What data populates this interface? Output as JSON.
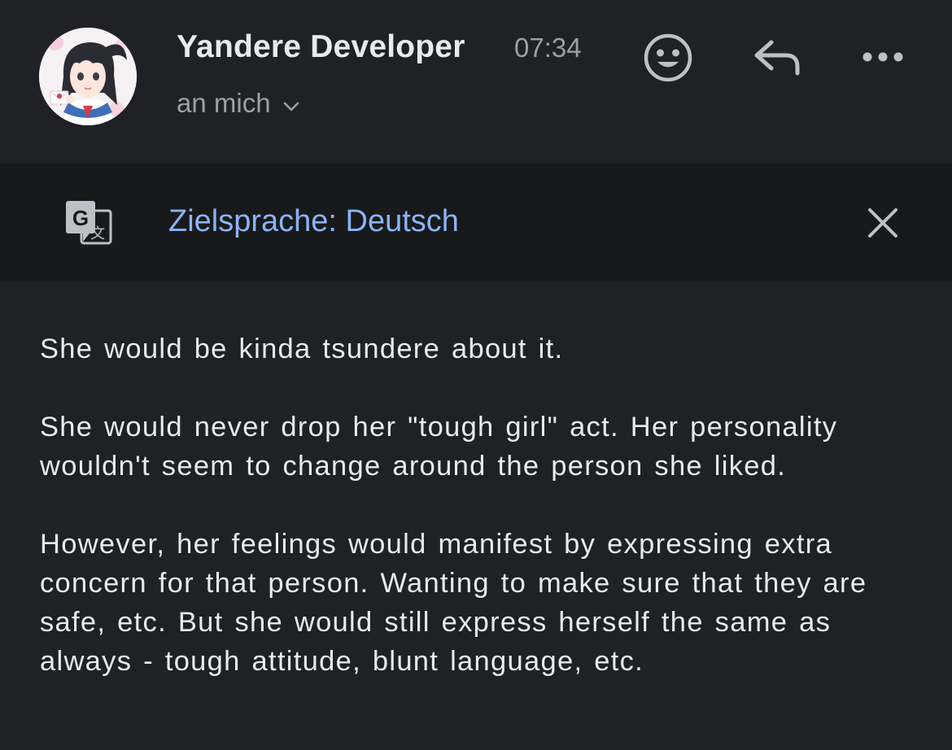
{
  "header": {
    "sender": "Yandere Developer",
    "time": "07:34",
    "recipient": "an mich",
    "avatar": "sender-avatar-anime-girl",
    "actions": [
      "emoji-icon",
      "reply-icon",
      "more-icon"
    ]
  },
  "translate_bar": {
    "label": "Zielsprache: Deutsch",
    "icon": "google-translate-icon",
    "close_icon": "close-icon"
  },
  "message": {
    "paragraphs": [
      "She would be kinda tsundere about it.",
      "She would never drop her \"tough girl\" act. Her personality wouldn't seem to change around the person she liked.",
      "However, her feelings would manifest by expressing extra concern for that person. Wanting to make sure that they are safe, etc. But she would still express herself the same as always - tough attitude, blunt language, etc."
    ]
  },
  "colors": {
    "background": "#202124",
    "translate_bar_background": "#18191a",
    "link_blue": "#8ab4f8",
    "muted_text": "#9aa0a6",
    "primary_text": "#e8eaed"
  }
}
